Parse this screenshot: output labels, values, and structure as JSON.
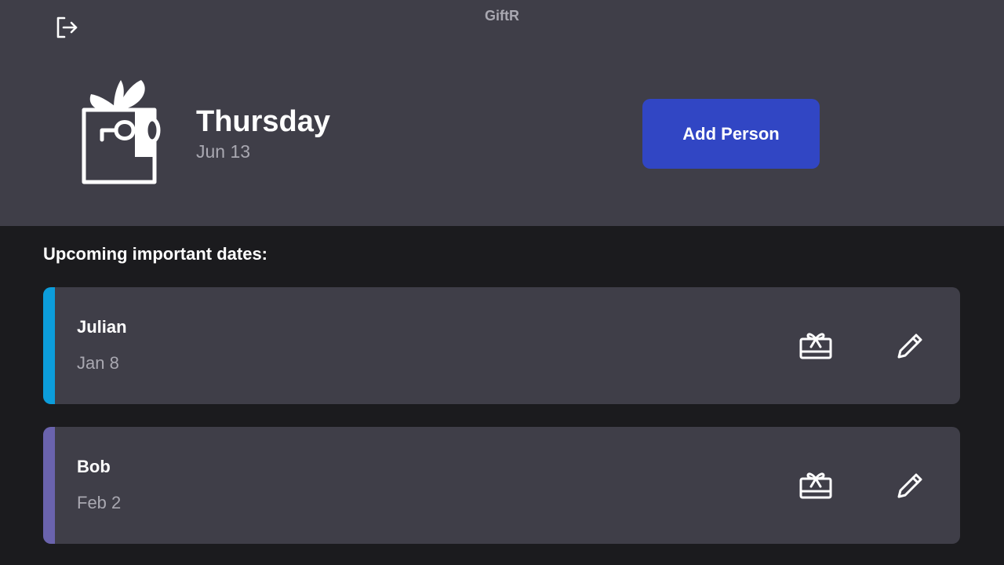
{
  "app": {
    "title": "GiftR"
  },
  "header": {
    "day": "Thursday",
    "date": "Jun 13",
    "add_person_label": "Add Person"
  },
  "section": {
    "title": "Upcoming important dates:"
  },
  "people": [
    {
      "name": "Julian",
      "date": "Jan 8",
      "accent": "#0c9ddb"
    },
    {
      "name": "Bob",
      "date": "Feb 2",
      "accent": "#6a63ad"
    }
  ],
  "icons": {
    "logout": "logout-icon",
    "logo": "gift-logo",
    "gift": "gift-icon",
    "edit": "pencil-icon"
  },
  "colors": {
    "header_bg": "#3f3e48",
    "page_bg": "#1b1b1e",
    "card_bg": "#3f3e48",
    "primary_button": "#3146c4",
    "muted_text": "#a9a8b1"
  }
}
